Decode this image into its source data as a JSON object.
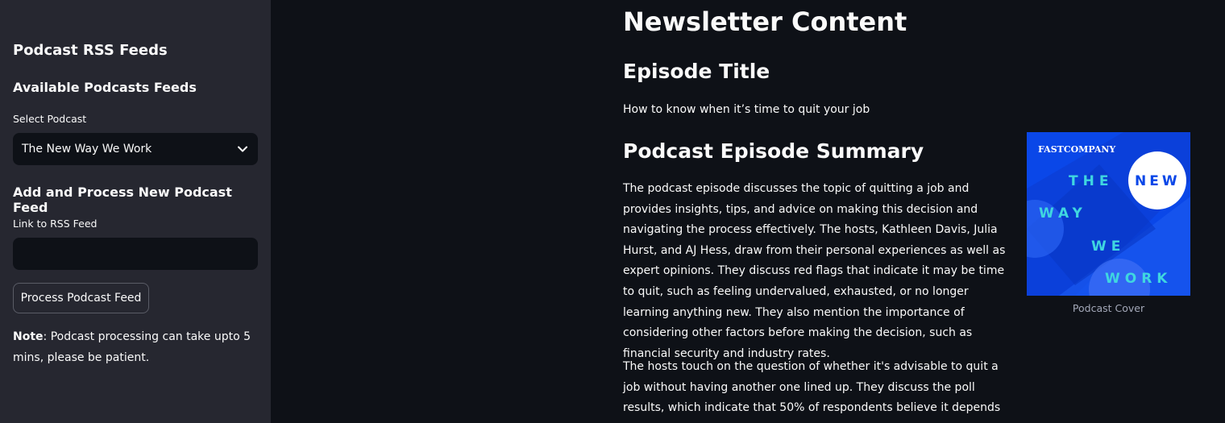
{
  "sidebar": {
    "title": "Podcast RSS Feeds",
    "available_heading": "Available Podcasts Feeds",
    "select_label": "Select Podcast",
    "select_value": "The New Way We Work",
    "add_heading": "Add and Process New Podcast Feed",
    "rss_label": "Link to RSS Feed",
    "rss_value": "",
    "process_button": "Process Podcast Feed",
    "note_bold": "Note",
    "note_text": ": Podcast processing can take upto 5 mins, please be patient."
  },
  "main": {
    "title": "Newsletter Content",
    "episode_title_heading": "Episode Title",
    "episode_title": "How to know when it’s time to quit your job",
    "summary_heading": "Podcast Episode Summary",
    "summary_p1": "The podcast episode discusses the topic of quitting a job and provides insights, tips, and advice on making this decision and navigating the process effectively. The hosts, Kathleen Davis, Julia Hurst, and AJ Hess, draw from their personal experiences as well as expert opinions. They discuss red flags that indicate it may be time to quit, such as feeling undervalued, exhausted, or no longer learning anything new. They also mention the importance of considering other factors before making the decision, such as financial security and industry rates.",
    "summary_p2": "The hosts touch on the question of whether it's advisable to quit a job without having another one lined up. They discuss the poll results, which indicate that 50% of respondents believe it depends on one's finances,",
    "cover_caption": "Podcast Cover",
    "cover_art": {
      "brand": "FASTCOMPANY",
      "words": [
        "THE",
        "NEW",
        "WAY",
        "WE",
        "WORK"
      ]
    }
  },
  "colors": {
    "background": "#0e1117",
    "sidebar": "#262730",
    "text": "#fafafa",
    "cover_blue": "#0a47e8",
    "cover_cyan": "#3fd6e0"
  }
}
